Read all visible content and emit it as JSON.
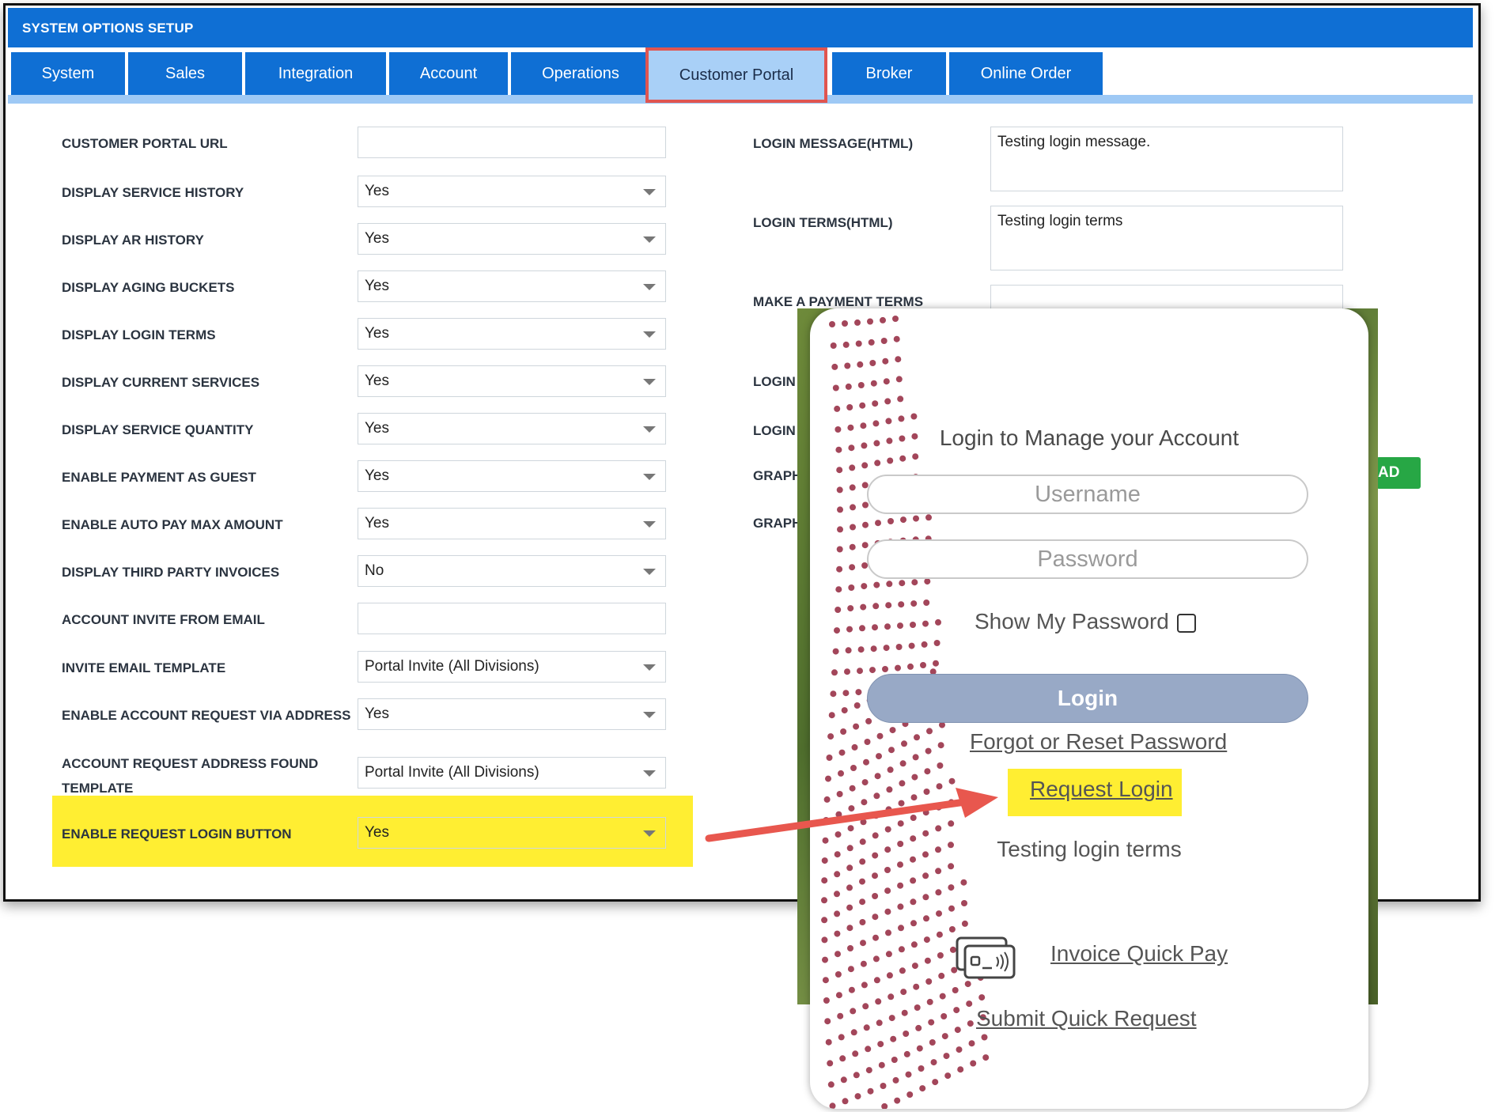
{
  "header": {
    "title": "SYSTEM OPTIONS SETUP"
  },
  "tabs": [
    {
      "label": "System"
    },
    {
      "label": "Sales"
    },
    {
      "label": "Integration"
    },
    {
      "label": "Account"
    },
    {
      "label": "Operations"
    },
    {
      "label": "Customer Portal"
    },
    {
      "label": "Broker"
    },
    {
      "label": "Online Order"
    }
  ],
  "active_tab": "Customer Portal",
  "settings": [
    {
      "label": "CUSTOMER PORTAL URL",
      "value": ""
    },
    {
      "label": "DISPLAY SERVICE HISTORY",
      "value": "Yes"
    },
    {
      "label": "DISPLAY AR HISTORY",
      "value": "Yes"
    },
    {
      "label": "DISPLAY AGING BUCKETS",
      "value": "Yes"
    },
    {
      "label": "DISPLAY LOGIN TERMS",
      "value": "Yes"
    },
    {
      "label": "DISPLAY CURRENT SERVICES",
      "value": "Yes"
    },
    {
      "label": "DISPLAY SERVICE QUANTITY",
      "value": "Yes"
    },
    {
      "label": "ENABLE PAYMENT AS GUEST",
      "value": "Yes"
    },
    {
      "label": "ENABLE AUTO PAY MAX AMOUNT",
      "value": "Yes"
    },
    {
      "label": "DISPLAY THIRD PARTY INVOICES",
      "value": "No"
    },
    {
      "label": "ACCOUNT INVITE FROM EMAIL",
      "value": ""
    },
    {
      "label": "INVITE EMAIL TEMPLATE",
      "value": "Portal Invite (All Divisions)"
    },
    {
      "label": "ENABLE ACCOUNT REQUEST VIA ADDRESS",
      "value": "Yes"
    },
    {
      "label_line1": "ACCOUNT REQUEST ADDRESS FOUND",
      "label_line2": "TEMPLATE",
      "value": "Portal Invite (All Divisions)"
    },
    {
      "label": "ENABLE REQUEST LOGIN BUTTON",
      "value": "Yes"
    }
  ],
  "right_settings": [
    {
      "label": "LOGIN MESSAGE(HTML)",
      "value": "Testing login message."
    },
    {
      "label": "LOGIN TERMS(HTML)",
      "value": "Testing login terms"
    },
    {
      "label": "MAKE A PAYMENT TERMS",
      "value": ""
    },
    {
      "label": "LOGIN"
    },
    {
      "label": "LOGIN"
    },
    {
      "label": "GRAPH"
    },
    {
      "label": "GRAPH"
    }
  ],
  "upload_button_fragment": "AD",
  "portal": {
    "title": "Login to Manage your Account",
    "username_placeholder": "Username",
    "password_placeholder": "Password",
    "show_password_label": "Show My Password",
    "login_button": "Login",
    "forgot_link": "Forgot or Reset Password",
    "request_login_link": "Request Login",
    "terms_text": "Testing login terms",
    "invoice_quick_pay": "Invoice Quick Pay",
    "submit_quick_request": "Submit Quick Request"
  },
  "colors": {
    "header_blue": "#0f6fd4",
    "active_tab": "#a9d0f7",
    "highlight_yellow": "#ffee32",
    "arrow_red": "#e8574e",
    "login_button": "#98a9c6",
    "upload_green": "#27a745"
  }
}
